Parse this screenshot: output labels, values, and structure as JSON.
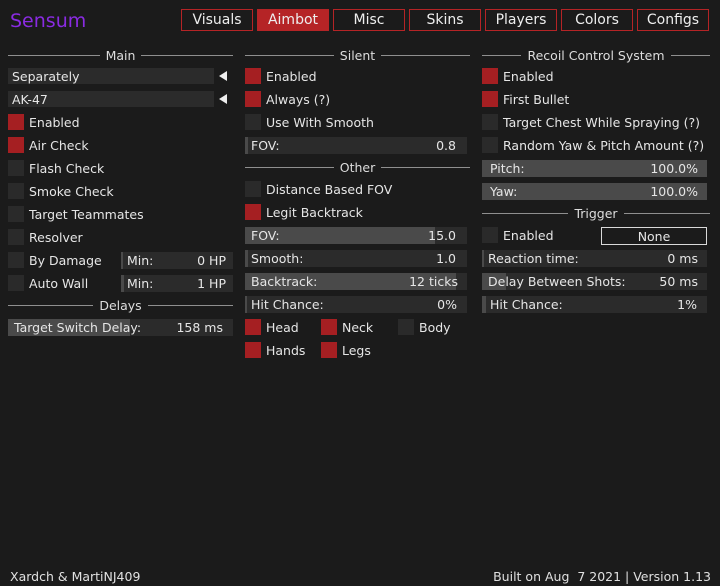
{
  "app": {
    "title": "Sensum",
    "accent": "#b52426",
    "checked_color": "#a51f22",
    "title_color": "#8a2be2"
  },
  "tabs": [
    {
      "label": "Visuals"
    },
    {
      "label": "Aimbot"
    },
    {
      "label": "Misc"
    },
    {
      "label": "Skins"
    },
    {
      "label": "Players"
    },
    {
      "label": "Colors"
    },
    {
      "label": "Configs"
    }
  ],
  "active_tab": "Aimbot",
  "main": {
    "header": "Main",
    "mode_select": "Separately",
    "weapon_select": "AK-47",
    "checks": [
      {
        "label": "Enabled",
        "checked": true
      },
      {
        "label": "Air Check",
        "checked": true
      },
      {
        "label": "Flash Check",
        "checked": false
      },
      {
        "label": "Smoke Check",
        "checked": false
      },
      {
        "label": "Target Teammates",
        "checked": false
      },
      {
        "label": "Resolver",
        "checked": false
      }
    ],
    "by_damage": {
      "label": "By Damage",
      "checked": false,
      "min_label": "Min:",
      "min_value": "0 HP"
    },
    "auto_wall": {
      "label": "Auto Wall",
      "checked": false,
      "min_label": "Min:",
      "min_value": "1 HP"
    },
    "delays_header": "Delays",
    "target_switch": {
      "label": "Target Switch Delay:",
      "value": "158 ms"
    }
  },
  "silent": {
    "header": "Silent",
    "checks": [
      {
        "label": "Enabled",
        "checked": true
      },
      {
        "label": "Always (?)",
        "checked": true
      },
      {
        "label": "Use With Smooth",
        "checked": false
      }
    ],
    "fov": {
      "label": "FOV:",
      "value": "0.8"
    }
  },
  "other": {
    "header": "Other",
    "distance_fov": {
      "label": "Distance Based FOV",
      "checked": false
    },
    "legit_backtrack": {
      "label": "Legit Backtrack",
      "checked": true
    },
    "fov": {
      "label": "FOV:",
      "value": "15.0"
    },
    "smooth": {
      "label": "Smooth:",
      "value": "1.0"
    },
    "backtrack": {
      "label": "Backtrack:",
      "value": "12 ticks"
    },
    "hit_chance": {
      "label": "Hit Chance:",
      "value": "0%"
    },
    "hitboxes": {
      "head": {
        "label": "Head",
        "checked": true
      },
      "neck": {
        "label": "Neck",
        "checked": true
      },
      "body": {
        "label": "Body",
        "checked": false
      },
      "hands": {
        "label": "Hands",
        "checked": true
      },
      "legs": {
        "label": "Legs",
        "checked": true
      }
    }
  },
  "rcs": {
    "header": "Recoil Control System",
    "checks": [
      {
        "label": "Enabled",
        "checked": true
      },
      {
        "label": "First Bullet",
        "checked": true
      },
      {
        "label": "Target Chest While Spraying (?)",
        "checked": false
      },
      {
        "label": "Random Yaw & Pitch Amount (?)",
        "checked": false
      }
    ],
    "pitch": {
      "label": "Pitch:",
      "value": "100.0%"
    },
    "yaw": {
      "label": "Yaw:",
      "value": "100.0%"
    }
  },
  "trigger": {
    "header": "Trigger",
    "enabled": {
      "label": "Enabled",
      "checked": false
    },
    "key": "None",
    "reaction": {
      "label": "Reaction time:",
      "value": "0 ms"
    },
    "delay": {
      "label": "Delay Between Shots:",
      "value": "50 ms"
    },
    "hit_chance": {
      "label": "Hit Chance:",
      "value": "1%"
    }
  },
  "footer": {
    "authors": "Xardch & MartiNJ409",
    "build": "Built on Aug  7 2021 | Version 1.13"
  }
}
